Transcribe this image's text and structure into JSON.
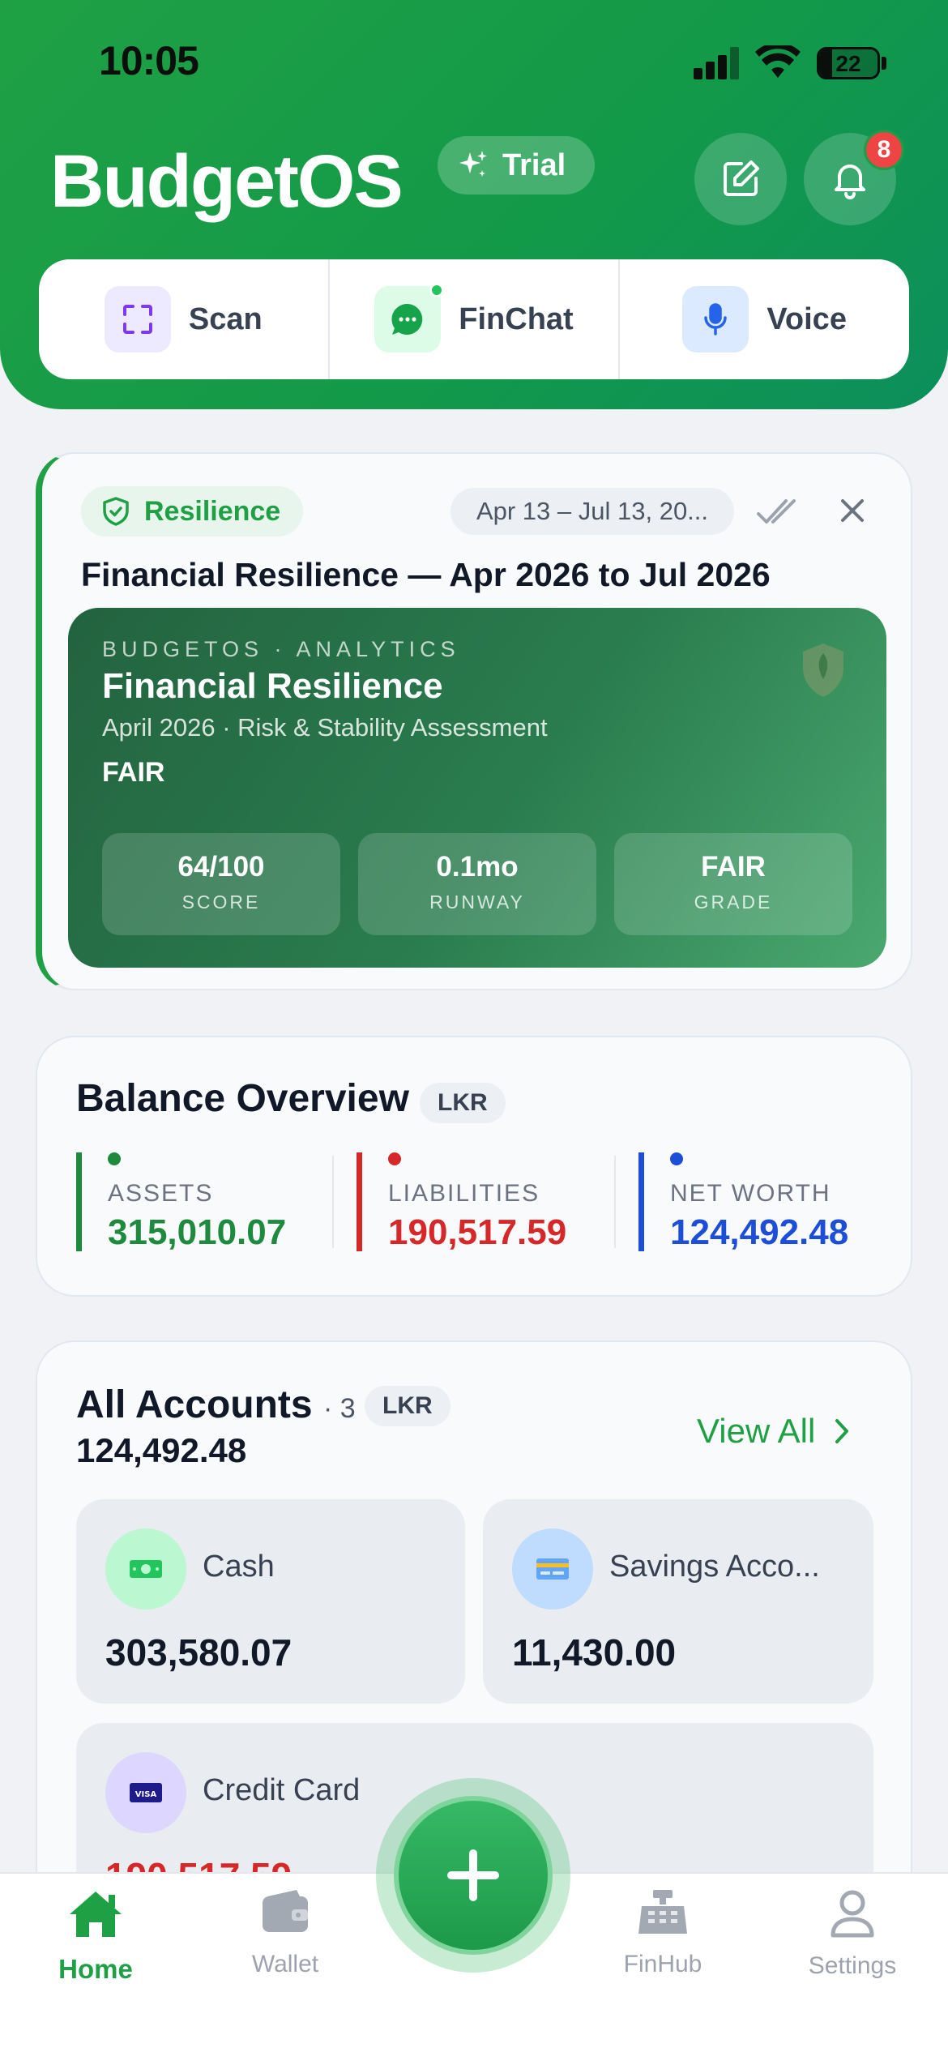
{
  "status_bar": {
    "time": "10:05",
    "battery": "22"
  },
  "header": {
    "brand": "BudgetOS",
    "trial_label": "Trial",
    "notification_count": "8",
    "quick_actions": [
      {
        "label": "Scan",
        "icon": "scan-icon"
      },
      {
        "label": "FinChat",
        "icon": "chat-icon"
      },
      {
        "label": "Voice",
        "icon": "microphone-icon"
      }
    ]
  },
  "resilience": {
    "tag": "Resilience",
    "date_range": "Apr 13 – Jul 13, 20...",
    "title": "Financial Resilience — Apr 2026 to Jul 2026",
    "report": {
      "kicker": "BUDGETOS · ANALYTICS",
      "title": "Financial Resilience",
      "subtitle": "April 2026 · Risk & Stability Assessment",
      "grade_label": "FAIR",
      "stats": [
        {
          "value": "64/100",
          "label": "SCORE"
        },
        {
          "value": "0.1mo",
          "label": "RUNWAY"
        },
        {
          "value": "FAIR",
          "label": "GRADE"
        }
      ]
    }
  },
  "balance": {
    "title": "Balance Overview",
    "currency": "LKR",
    "assets": {
      "label": "ASSETS",
      "value": "315,010.07"
    },
    "liabilities": {
      "label": "LIABILITIES",
      "value": "190,517.59"
    },
    "net_worth": {
      "label": "NET WORTH",
      "value": "124,492.48"
    }
  },
  "accounts": {
    "title": "All Accounts",
    "count": "· 3",
    "currency": "LKR",
    "total": "124,492.48",
    "view_all": "View All",
    "items": [
      {
        "name": "Cash",
        "amount": "303,580.07",
        "icon": "cash-icon"
      },
      {
        "name": "Savings Acco...",
        "amount": "11,430.00",
        "icon": "bank-card-icon"
      },
      {
        "name": "Credit Card",
        "amount": "190,517.59",
        "icon": "visa-card-icon"
      }
    ]
  },
  "nav": {
    "items": [
      {
        "label": "Home",
        "icon": "home-icon"
      },
      {
        "label": "Wallet",
        "icon": "wallet-icon"
      },
      {
        "label": "FinHub",
        "icon": "register-icon"
      },
      {
        "label": "Settings",
        "icon": "user-icon"
      }
    ],
    "active": "Home"
  },
  "colors": {
    "brand_green": "#1fa045",
    "assets": "#1e8a3e",
    "liabilities": "#d62828",
    "net_worth": "#1d4ed8"
  }
}
